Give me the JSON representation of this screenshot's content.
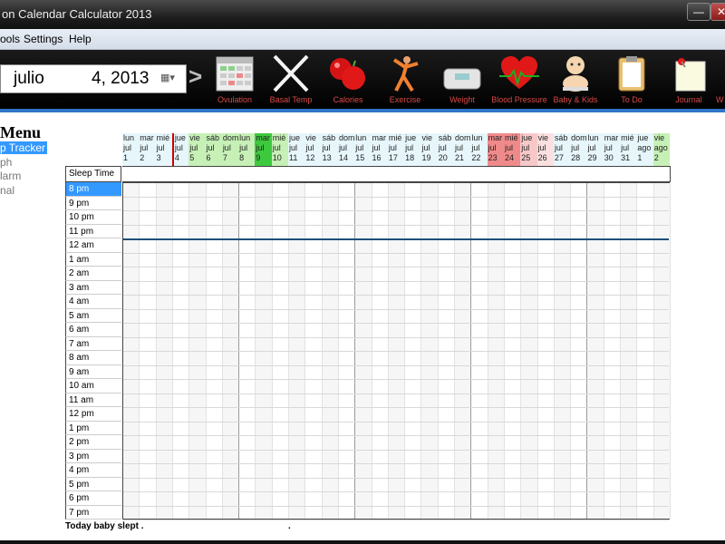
{
  "window": {
    "title": "on Calendar Calculator 2013",
    "min": "—",
    "close": "✕"
  },
  "menubar": [
    "ools",
    "Settings",
    "Help"
  ],
  "date": {
    "month": "julio",
    "day_year": "4, 2013",
    "next": ">"
  },
  "toolbar": [
    {
      "label": "Ovulation",
      "icon": "calendar-icon"
    },
    {
      "label": "Basal Temp",
      "icon": "thermometer-cross-icon"
    },
    {
      "label": "Calories",
      "icon": "apple-icon"
    },
    {
      "label": "Exercise",
      "icon": "exercise-person-icon"
    },
    {
      "label": "Weight",
      "icon": "scale-icon"
    },
    {
      "label": "Blood Pressure",
      "icon": "heart-icon"
    },
    {
      "label": "Baby & Kids",
      "icon": "baby-icon"
    },
    {
      "label": "To Do",
      "icon": "clipboard-icon"
    },
    {
      "label": "Journal",
      "icon": "note-pin-icon"
    },
    {
      "label": "W",
      "icon": "more-icon"
    }
  ],
  "side_menu": {
    "title": "Menu",
    "items": [
      {
        "label": "p Tracker",
        "selected": true
      },
      {
        "label": "ph",
        "selected": false
      },
      {
        "label": "larm",
        "selected": false
      },
      {
        "label": "nal",
        "selected": false
      }
    ]
  },
  "days": [
    {
      "dow": "lun",
      "mon": "jul",
      "d": "1",
      "color": "#e6f6fb"
    },
    {
      "dow": "mar",
      "mon": "jul",
      "d": "2",
      "color": "#e6f6fb"
    },
    {
      "dow": "mié",
      "mon": "jul",
      "d": "3",
      "color": "#e6f6fb"
    },
    {
      "dow": "jue",
      "mon": "jul",
      "d": "4",
      "color": "#e6f6fb"
    },
    {
      "dow": "vie",
      "mon": "jul",
      "d": "5",
      "color": "#c6f0b6"
    },
    {
      "dow": "sáb",
      "mon": "jul",
      "d": "6",
      "color": "#c6f0b6"
    },
    {
      "dow": "dom",
      "mon": "jul",
      "d": "7",
      "color": "#c6f0b6"
    },
    {
      "dow": "lun",
      "mon": "jul",
      "d": "8",
      "color": "#c6f0b6"
    },
    {
      "dow": "mar",
      "mon": "jul",
      "d": "9",
      "color": "#3ec83e"
    },
    {
      "dow": "mié",
      "mon": "jul",
      "d": "10",
      "color": "#c6f0b6"
    },
    {
      "dow": "jue",
      "mon": "jul",
      "d": "11",
      "color": "#e6f6fb"
    },
    {
      "dow": "vie",
      "mon": "jul",
      "d": "12",
      "color": "#e6f6fb"
    },
    {
      "dow": "sáb",
      "mon": "jul",
      "d": "13",
      "color": "#e6f6fb"
    },
    {
      "dow": "dom",
      "mon": "jul",
      "d": "14",
      "color": "#e6f6fb"
    },
    {
      "dow": "lun",
      "mon": "jul",
      "d": "15",
      "color": "#e6f6fb"
    },
    {
      "dow": "mar",
      "mon": "jul",
      "d": "16",
      "color": "#e6f6fb"
    },
    {
      "dow": "mié",
      "mon": "jul",
      "d": "17",
      "color": "#e6f6fb"
    },
    {
      "dow": "jue",
      "mon": "jul",
      "d": "18",
      "color": "#e6f6fb"
    },
    {
      "dow": "vie",
      "mon": "jul",
      "d": "19",
      "color": "#e6f6fb"
    },
    {
      "dow": "sáb",
      "mon": "jul",
      "d": "20",
      "color": "#e6f6fb"
    },
    {
      "dow": "dom",
      "mon": "jul",
      "d": "21",
      "color": "#e6f6fb"
    },
    {
      "dow": "lun",
      "mon": "jul",
      "d": "22",
      "color": "#e6f6fb"
    },
    {
      "dow": "mar",
      "mon": "jul",
      "d": "23",
      "color": "#f08a8a"
    },
    {
      "dow": "mié",
      "mon": "jul",
      "d": "24",
      "color": "#f08a8a"
    },
    {
      "dow": "jue",
      "mon": "jul",
      "d": "25",
      "color": "#f8c8c8"
    },
    {
      "dow": "vie",
      "mon": "jul",
      "d": "26",
      "color": "#fbe0e0"
    },
    {
      "dow": "sáb",
      "mon": "jul",
      "d": "27",
      "color": "#e6f6fb"
    },
    {
      "dow": "dom",
      "mon": "jul",
      "d": "28",
      "color": "#e6f6fb"
    },
    {
      "dow": "lun",
      "mon": "jul",
      "d": "29",
      "color": "#e6f6fb"
    },
    {
      "dow": "mar",
      "mon": "jul",
      "d": "30",
      "color": "#e6f6fb"
    },
    {
      "dow": "mié",
      "mon": "jul",
      "d": "31",
      "color": "#e6f6fb"
    },
    {
      "dow": "jue",
      "mon": "ago",
      "d": "1",
      "color": "#e6f6fb"
    },
    {
      "dow": "vie",
      "mon": "ago",
      "d": "2",
      "color": "#c6f0b6"
    }
  ],
  "today_index": 3,
  "today_marker_color": "#cc0000",
  "grid_line_color": "#1f4e79",
  "sleep_label": "Sleep Time",
  "hours": [
    "8 pm",
    "9 pm",
    "10 pm",
    "11 pm",
    "12 am",
    "1 am",
    "2 am",
    "3 am",
    "4 am",
    "5 am",
    "6 am",
    "7 am",
    "8 am",
    "9 am",
    "10 am",
    "11 am",
    "12 pm",
    "1 pm",
    "2 pm",
    "3 pm",
    "4 pm",
    "5 pm",
    "6 pm",
    "7 pm"
  ],
  "footer": {
    "text": "Today baby slept .",
    "dot": "."
  }
}
